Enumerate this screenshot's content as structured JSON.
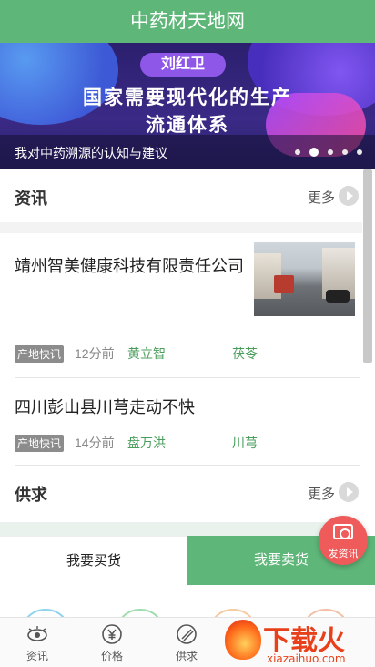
{
  "app_title": "中药材天地网",
  "banner": {
    "author": "刘红卫",
    "title_line1": "国家需要现代化的生产",
    "title_line2": "流通体系",
    "caption": "我对中药溯源的认知与建议",
    "slide_count": 5,
    "active_slide": 2
  },
  "news_section": {
    "title": "资讯",
    "more_label": "更多",
    "items": [
      {
        "title": "靖州智美健康科技有限责任公司",
        "tag": "产地快讯",
        "time": "12分前",
        "author": "黄立智",
        "herb": "茯苓",
        "has_thumbnail": true
      },
      {
        "title": "四川彭山县川芎走动不快",
        "tag": "产地快讯",
        "time": "14分前",
        "author": "盘万洪",
        "herb": "川芎",
        "has_thumbnail": false
      }
    ]
  },
  "supply_section": {
    "title": "供求",
    "more_label": "更多"
  },
  "trade_tabs": {
    "buy_label": "我要买货",
    "sell_label": "我要卖货"
  },
  "fab": {
    "label": "发资讯",
    "icon": "camera-icon"
  },
  "tabbar": [
    {
      "label": "资讯",
      "icon": "eye-icon"
    },
    {
      "label": "价格",
      "icon": "yuan-icon"
    },
    {
      "label": "供求",
      "icon": "supply-icon"
    }
  ],
  "watermark": {
    "text": "下载火",
    "sub": "xiazaihuo.com"
  },
  "colors": {
    "primary_green": "#5fb679",
    "link_green": "#4a9e5c",
    "fab_red": "#ef5b5b",
    "banner_bg": "#2b1f6e"
  }
}
